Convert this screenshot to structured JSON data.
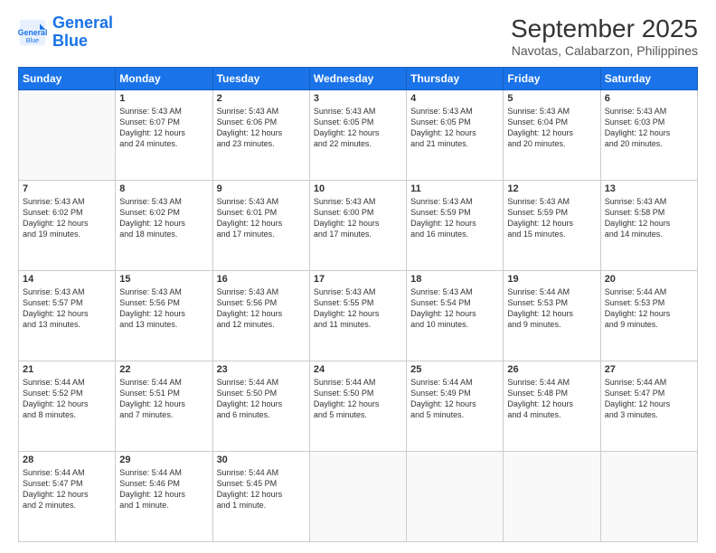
{
  "header": {
    "logo_line1": "General",
    "logo_line2": "Blue",
    "title": "September 2025",
    "subtitle": "Navotas, Calabarzon, Philippines"
  },
  "days_of_week": [
    "Sunday",
    "Monday",
    "Tuesday",
    "Wednesday",
    "Thursday",
    "Friday",
    "Saturday"
  ],
  "weeks": [
    [
      {
        "day": "",
        "info": ""
      },
      {
        "day": "1",
        "info": "Sunrise: 5:43 AM\nSunset: 6:07 PM\nDaylight: 12 hours\nand 24 minutes."
      },
      {
        "day": "2",
        "info": "Sunrise: 5:43 AM\nSunset: 6:06 PM\nDaylight: 12 hours\nand 23 minutes."
      },
      {
        "day": "3",
        "info": "Sunrise: 5:43 AM\nSunset: 6:05 PM\nDaylight: 12 hours\nand 22 minutes."
      },
      {
        "day": "4",
        "info": "Sunrise: 5:43 AM\nSunset: 6:05 PM\nDaylight: 12 hours\nand 21 minutes."
      },
      {
        "day": "5",
        "info": "Sunrise: 5:43 AM\nSunset: 6:04 PM\nDaylight: 12 hours\nand 20 minutes."
      },
      {
        "day": "6",
        "info": "Sunrise: 5:43 AM\nSunset: 6:03 PM\nDaylight: 12 hours\nand 20 minutes."
      }
    ],
    [
      {
        "day": "7",
        "info": "Sunrise: 5:43 AM\nSunset: 6:02 PM\nDaylight: 12 hours\nand 19 minutes."
      },
      {
        "day": "8",
        "info": "Sunrise: 5:43 AM\nSunset: 6:02 PM\nDaylight: 12 hours\nand 18 minutes."
      },
      {
        "day": "9",
        "info": "Sunrise: 5:43 AM\nSunset: 6:01 PM\nDaylight: 12 hours\nand 17 minutes."
      },
      {
        "day": "10",
        "info": "Sunrise: 5:43 AM\nSunset: 6:00 PM\nDaylight: 12 hours\nand 17 minutes."
      },
      {
        "day": "11",
        "info": "Sunrise: 5:43 AM\nSunset: 5:59 PM\nDaylight: 12 hours\nand 16 minutes."
      },
      {
        "day": "12",
        "info": "Sunrise: 5:43 AM\nSunset: 5:59 PM\nDaylight: 12 hours\nand 15 minutes."
      },
      {
        "day": "13",
        "info": "Sunrise: 5:43 AM\nSunset: 5:58 PM\nDaylight: 12 hours\nand 14 minutes."
      }
    ],
    [
      {
        "day": "14",
        "info": "Sunrise: 5:43 AM\nSunset: 5:57 PM\nDaylight: 12 hours\nand 13 minutes."
      },
      {
        "day": "15",
        "info": "Sunrise: 5:43 AM\nSunset: 5:56 PM\nDaylight: 12 hours\nand 13 minutes."
      },
      {
        "day": "16",
        "info": "Sunrise: 5:43 AM\nSunset: 5:56 PM\nDaylight: 12 hours\nand 12 minutes."
      },
      {
        "day": "17",
        "info": "Sunrise: 5:43 AM\nSunset: 5:55 PM\nDaylight: 12 hours\nand 11 minutes."
      },
      {
        "day": "18",
        "info": "Sunrise: 5:43 AM\nSunset: 5:54 PM\nDaylight: 12 hours\nand 10 minutes."
      },
      {
        "day": "19",
        "info": "Sunrise: 5:44 AM\nSunset: 5:53 PM\nDaylight: 12 hours\nand 9 minutes."
      },
      {
        "day": "20",
        "info": "Sunrise: 5:44 AM\nSunset: 5:53 PM\nDaylight: 12 hours\nand 9 minutes."
      }
    ],
    [
      {
        "day": "21",
        "info": "Sunrise: 5:44 AM\nSunset: 5:52 PM\nDaylight: 12 hours\nand 8 minutes."
      },
      {
        "day": "22",
        "info": "Sunrise: 5:44 AM\nSunset: 5:51 PM\nDaylight: 12 hours\nand 7 minutes."
      },
      {
        "day": "23",
        "info": "Sunrise: 5:44 AM\nSunset: 5:50 PM\nDaylight: 12 hours\nand 6 minutes."
      },
      {
        "day": "24",
        "info": "Sunrise: 5:44 AM\nSunset: 5:50 PM\nDaylight: 12 hours\nand 5 minutes."
      },
      {
        "day": "25",
        "info": "Sunrise: 5:44 AM\nSunset: 5:49 PM\nDaylight: 12 hours\nand 5 minutes."
      },
      {
        "day": "26",
        "info": "Sunrise: 5:44 AM\nSunset: 5:48 PM\nDaylight: 12 hours\nand 4 minutes."
      },
      {
        "day": "27",
        "info": "Sunrise: 5:44 AM\nSunset: 5:47 PM\nDaylight: 12 hours\nand 3 minutes."
      }
    ],
    [
      {
        "day": "28",
        "info": "Sunrise: 5:44 AM\nSunset: 5:47 PM\nDaylight: 12 hours\nand 2 minutes."
      },
      {
        "day": "29",
        "info": "Sunrise: 5:44 AM\nSunset: 5:46 PM\nDaylight: 12 hours\nand 1 minute."
      },
      {
        "day": "30",
        "info": "Sunrise: 5:44 AM\nSunset: 5:45 PM\nDaylight: 12 hours\nand 1 minute."
      },
      {
        "day": "",
        "info": ""
      },
      {
        "day": "",
        "info": ""
      },
      {
        "day": "",
        "info": ""
      },
      {
        "day": "",
        "info": ""
      }
    ]
  ]
}
